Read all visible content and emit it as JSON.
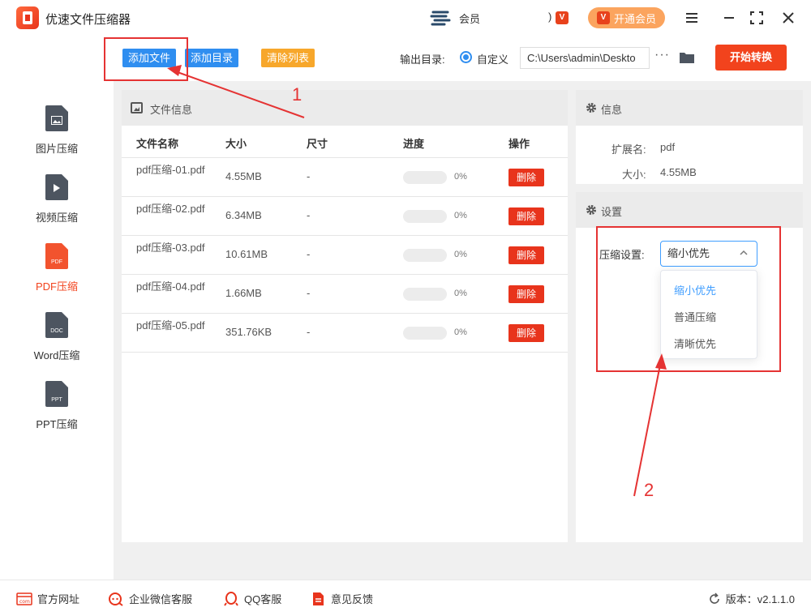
{
  "app": {
    "title": "优速文件压缩器",
    "user_name": "会员",
    "user_extra": ")",
    "vip_badge": "V",
    "vip_button_label": "开通会员"
  },
  "window_controls": [
    "menu-icon",
    "minimize-icon",
    "maximize-icon",
    "close-icon"
  ],
  "toolbar": {
    "add_file": "添加文件",
    "add_dir": "添加目录",
    "clear_list": "清除列表",
    "output_label": "输出目录:",
    "custom_label": "自定义",
    "output_path": "C:\\Users\\admin\\Deskto",
    "more": "···",
    "start": "开始转换"
  },
  "sidebar": {
    "items": [
      {
        "label": "图片压缩",
        "icon": "image-file-icon",
        "tag": "",
        "active": false
      },
      {
        "label": "视频压缩",
        "icon": "video-file-icon",
        "tag": "",
        "active": false
      },
      {
        "label": "PDF压缩",
        "icon": "pdf-file-icon",
        "tag": "PDF",
        "active": true
      },
      {
        "label": "Word压缩",
        "icon": "doc-file-icon",
        "tag": "DOC",
        "active": false
      },
      {
        "label": "PPT压缩",
        "icon": "ppt-file-icon",
        "tag": "PPT",
        "active": false
      }
    ]
  },
  "file_panel": {
    "title": "文件信息",
    "columns": [
      "文件名称",
      "大小",
      "尺寸",
      "进度",
      "操作"
    ],
    "rows": [
      {
        "name": "pdf压缩-01.pdf",
        "size": "4.55MB",
        "dim": "-",
        "progress": "0%",
        "action": "删除"
      },
      {
        "name": "pdf压缩-02.pdf",
        "size": "6.34MB",
        "dim": "-",
        "progress": "0%",
        "action": "删除"
      },
      {
        "name": "pdf压缩-03.pdf",
        "size": "10.61MB",
        "dim": "-",
        "progress": "0%",
        "action": "删除"
      },
      {
        "name": "pdf压缩-04.pdf",
        "size": "1.66MB",
        "dim": "-",
        "progress": "0%",
        "action": "删除"
      },
      {
        "name": "pdf压缩-05.pdf",
        "size": "351.76KB",
        "dim": "-",
        "progress": "0%",
        "action": "删除"
      }
    ]
  },
  "info_panel": {
    "title": "信息",
    "ext_label": "扩展名:",
    "ext_value": "pdf",
    "size_label": "大小:",
    "size_value": "4.55MB"
  },
  "settings_panel": {
    "title": "设置",
    "compress_label": "压缩设置:",
    "selected": "缩小优先",
    "options": [
      "缩小优先",
      "普通压缩",
      "清晰优先"
    ]
  },
  "footer": {
    "website": "官方网址",
    "wechat": "企业微信客服",
    "qq": "QQ客服",
    "feedback": "意见反馈",
    "version": "版本：v2.1.1.0"
  },
  "annotations": {
    "one": "1",
    "two": "2"
  },
  "colors": {
    "primary_blue": "#2f8ef0",
    "accent_orange": "#f7a72b",
    "start_red": "#f2431d",
    "vip_orange": "#fba45e",
    "annotation_red": "#e53333"
  }
}
